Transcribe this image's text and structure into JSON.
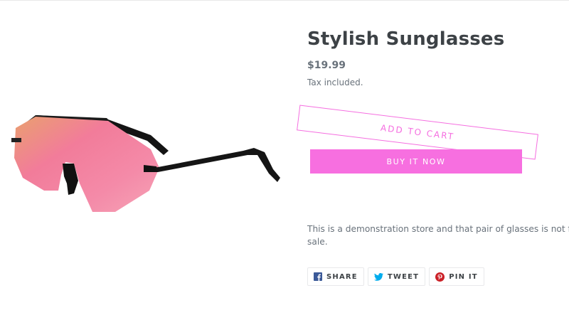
{
  "product": {
    "title": "Stylish Sunglasses",
    "price": "$19.99",
    "tax_note": "Tax included.",
    "image_icon": "sunglasses-image"
  },
  "actions": {
    "add_to_cart_label": "ADD TO CART",
    "buy_now_label": "BUY IT NOW"
  },
  "description": {
    "line1": "This is a demonstration store and that pair of glasses is not f",
    "line2": "sale."
  },
  "share": {
    "facebook_label": "SHARE",
    "twitter_label": "TWEET",
    "pinterest_label": "PIN IT"
  },
  "colors": {
    "accent": "#f76fe0",
    "text": "#3d4246",
    "muted": "#69727b",
    "facebook": "#3b5998",
    "twitter": "#00aced",
    "pinterest": "#cb2027"
  }
}
